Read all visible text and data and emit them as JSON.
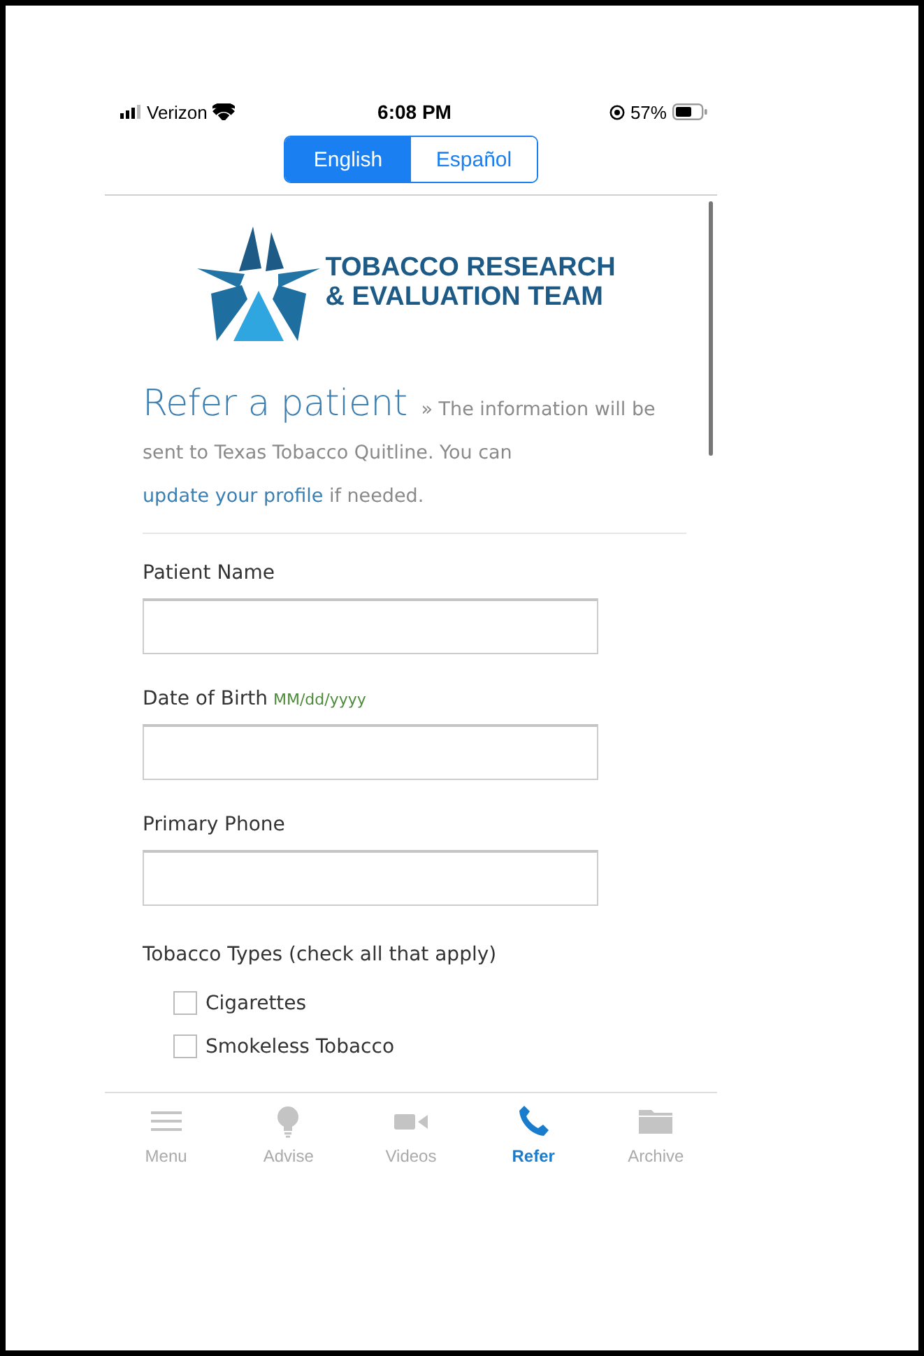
{
  "status_bar": {
    "carrier": "Verizon",
    "time": "6:08 PM",
    "battery": "57%"
  },
  "language_toggle": [
    {
      "label": "English",
      "selected": true
    },
    {
      "label": "Español",
      "selected": false
    }
  ],
  "logo": {
    "line_1": "TOBACCO RESEARCH",
    "line_2": "& EVALUATION TEAM"
  },
  "heading": "Refer a patient",
  "intro": {
    "before": "» The information will be sent to Texas Tobacco Quitline. You can",
    "link": "update your profile",
    "after": "if needed."
  },
  "fields": [
    {
      "label": "Patient Name"
    },
    {
      "label": "Date of Birth",
      "hint": "MM/dd/yyyy"
    },
    {
      "label": "Primary Phone"
    }
  ],
  "tobacco_types": {
    "label": "Tobacco Types (check all that apply)",
    "options": [
      {
        "label": "Cigarettes",
        "checked": false
      },
      {
        "label": "Smokeless Tobacco",
        "checked": false
      }
    ]
  },
  "tab_bar": [
    {
      "label": "Menu",
      "selected": false
    },
    {
      "label": "Advise",
      "selected": false
    },
    {
      "label": "Videos",
      "selected": false
    },
    {
      "label": "Refer",
      "selected": true
    },
    {
      "label": "Archive",
      "selected": false
    }
  ]
}
